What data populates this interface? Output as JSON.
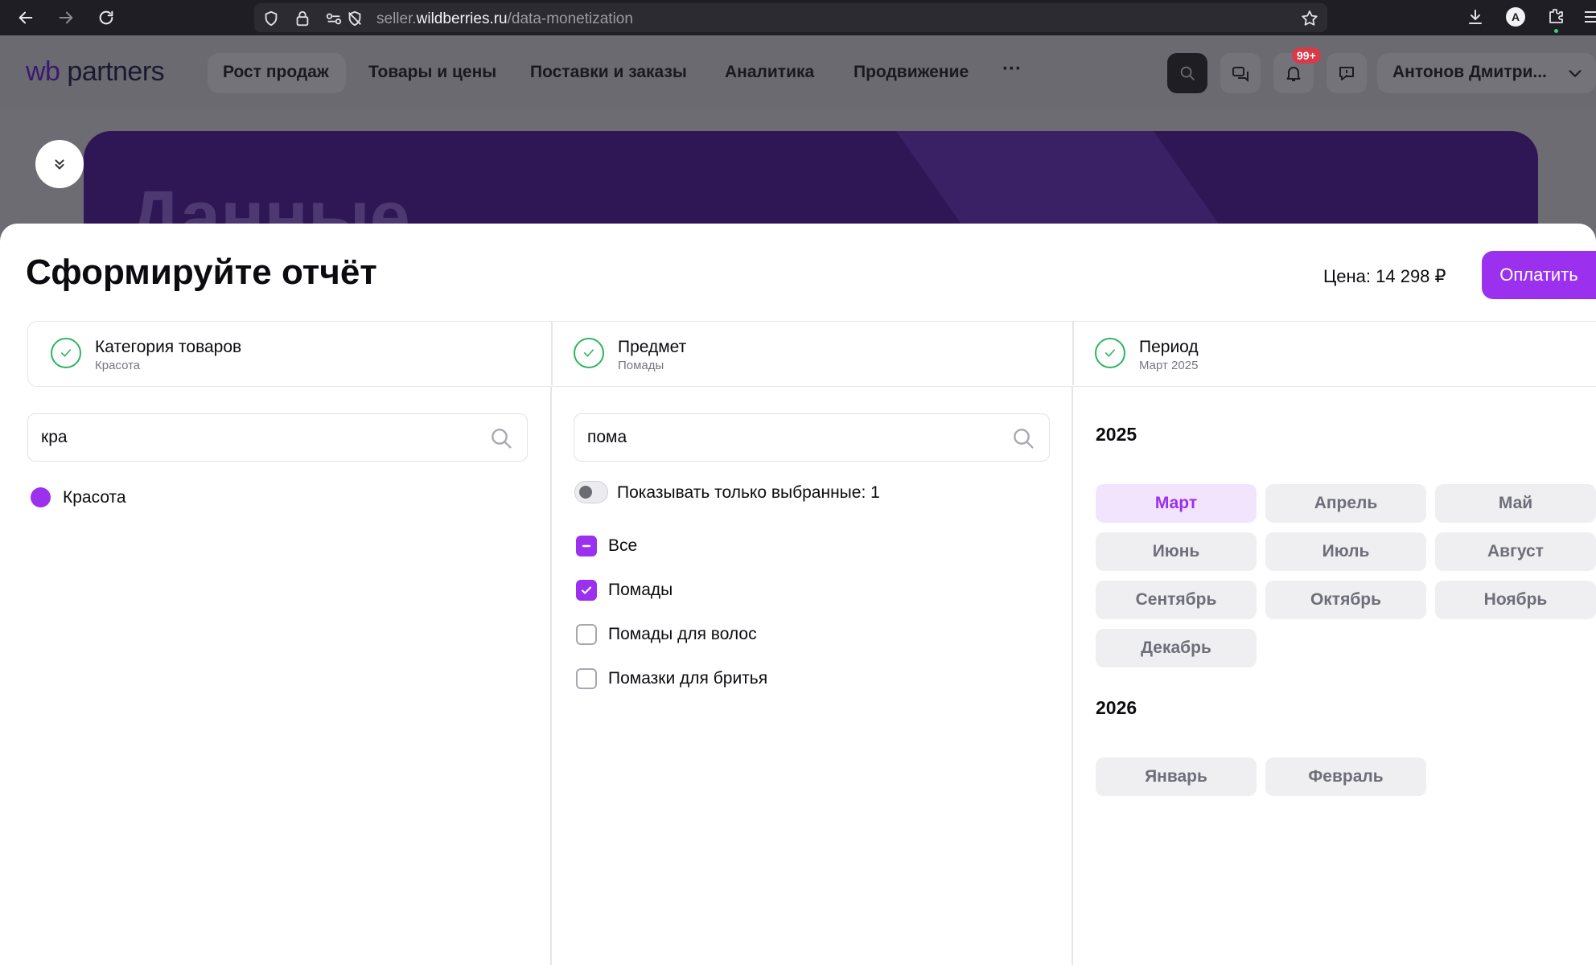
{
  "browser": {
    "url_prefix": "seller.",
    "url_domain": "wildberries.ru",
    "url_path": "/data-monetization",
    "profile_letter": "A"
  },
  "header": {
    "logo_wb": "wb",
    "logo_partners": "partners",
    "nav": [
      "Рост продаж",
      "Товары и цены",
      "Поставки и заказы",
      "Аналитика",
      "Продвижение"
    ],
    "more": "···",
    "notifications_badge": "99+",
    "user_name": "Антонов Дмитри..."
  },
  "banner": {
    "text": "Данные"
  },
  "report": {
    "title": "Сформируйте отчёт",
    "price": "Цена: 14 298 ₽",
    "pay_label": "Оплатить"
  },
  "steps": [
    {
      "title": "Категория товаров",
      "subtitle": "Красота"
    },
    {
      "title": "Предмет",
      "subtitle": "Помады"
    },
    {
      "title": "Период",
      "subtitle": "Март 2025"
    }
  ],
  "category": {
    "search_value": "кра",
    "options": [
      {
        "label": "Красота",
        "selected": true
      }
    ]
  },
  "subject": {
    "search_value": "пома",
    "toggle_label": "Показывать только выбранные: 1",
    "toggle_on": false,
    "items": [
      {
        "label": "Все",
        "state": "indeterminate"
      },
      {
        "label": "Помады",
        "state": "checked"
      },
      {
        "label": "Помады для волос",
        "state": "unchecked"
      },
      {
        "label": "Помазки для бритья",
        "state": "unchecked"
      }
    ]
  },
  "period": {
    "years": [
      {
        "year": "2025",
        "months": [
          "Март",
          "Апрель",
          "Май",
          "Июнь",
          "Июль",
          "Август",
          "Сентябрь",
          "Октябрь",
          "Ноябрь",
          "Декабрь"
        ]
      },
      {
        "year": "2026",
        "months": [
          "Январь",
          "Февраль"
        ]
      }
    ],
    "selected": "Март"
  },
  "colors": {
    "accent": "#9b30ef",
    "accent_light": "#f3e4fd",
    "success": "#2fb55e",
    "month_bg": "#efeff2",
    "banner": "#2f1756",
    "badge": "#d93a4a"
  }
}
